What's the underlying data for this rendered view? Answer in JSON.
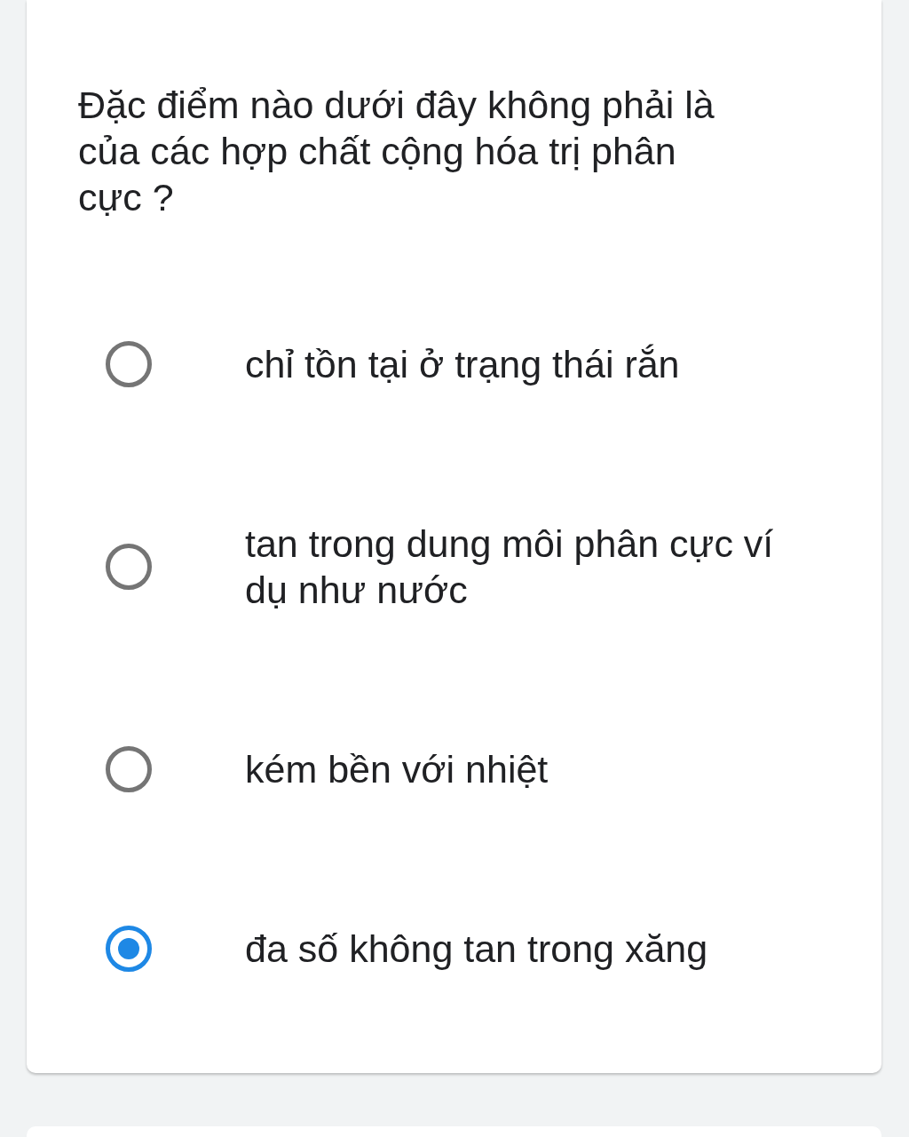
{
  "question": {
    "text": "Đặc điểm nào dưới đây không phải là của các hợp chất cộng hóa trị phân cực ?"
  },
  "options": [
    {
      "label": "chỉ tồn tại ở trạng thái rắn",
      "selected": false
    },
    {
      "label": "tan trong dung môi phân cực ví dụ như nước",
      "selected": false
    },
    {
      "label": "kém bền với nhiệt",
      "selected": false
    },
    {
      "label": "đa số không tan trong xăng",
      "selected": true
    }
  ]
}
